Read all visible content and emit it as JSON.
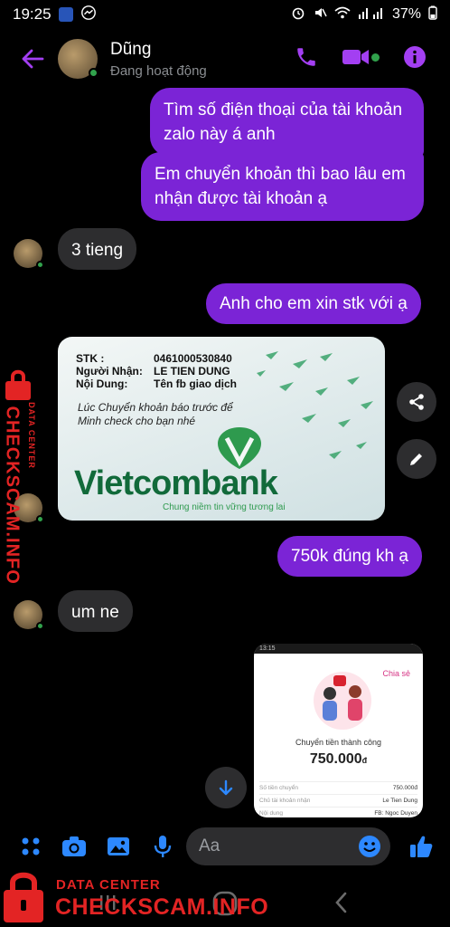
{
  "status_bar": {
    "time": "19:25",
    "battery": "37%"
  },
  "header": {
    "name": "Dũng",
    "status": "Đang hoạt động"
  },
  "messages": {
    "m1": "Tìm số điện thoại của tài khoản zalo này á anh",
    "m2": "Em chuyển khoản thì bao lâu em nhận được tài khoản ạ",
    "m3": "3 tieng",
    "m4": "Anh cho em xin stk với ạ",
    "m5": "750k đúng kh ạ",
    "m6": "um ne"
  },
  "bank_card": {
    "stk_label": "STK :",
    "stk_value": "0461000530840",
    "receiver_label": "Người Nhận:",
    "receiver_value": "LE TIEN DUNG",
    "content_label": "Nội Dung:",
    "content_value": "Tên fb giao dịch",
    "note": "Lúc Chuyển khoản báo trước để Minh check cho bạn nhé",
    "brand": "Vietcombank",
    "slogan": "Chung niềm tin vững tương lai"
  },
  "receipt": {
    "time": "13:15",
    "share": "Chia sẻ",
    "title": "Chuyển tiền thành công",
    "amount": "750.000",
    "currency": "đ",
    "rows": [
      {
        "label": "Số tiền chuyển",
        "value": "750.000đ"
      },
      {
        "label": "Chủ tài khoản nhận",
        "value": "Le Tien Dung"
      },
      {
        "label": "Nội dung",
        "value": "FB: Ngoc Duyen"
      }
    ]
  },
  "composer": {
    "placeholder": "Aa"
  },
  "watermark": {
    "line1": "DATA CENTER",
    "line2": "CHECKSCAM.INFO"
  },
  "colors": {
    "accent": "#7b24d6",
    "icon": "#a33ff2",
    "blue": "#2d88ff",
    "watermark": "#e32424"
  },
  "icons": [
    "back-arrow",
    "phone",
    "video",
    "info",
    "share",
    "edit",
    "scroll-down",
    "apps",
    "camera",
    "image",
    "microphone",
    "emoji",
    "thumbs-up"
  ]
}
